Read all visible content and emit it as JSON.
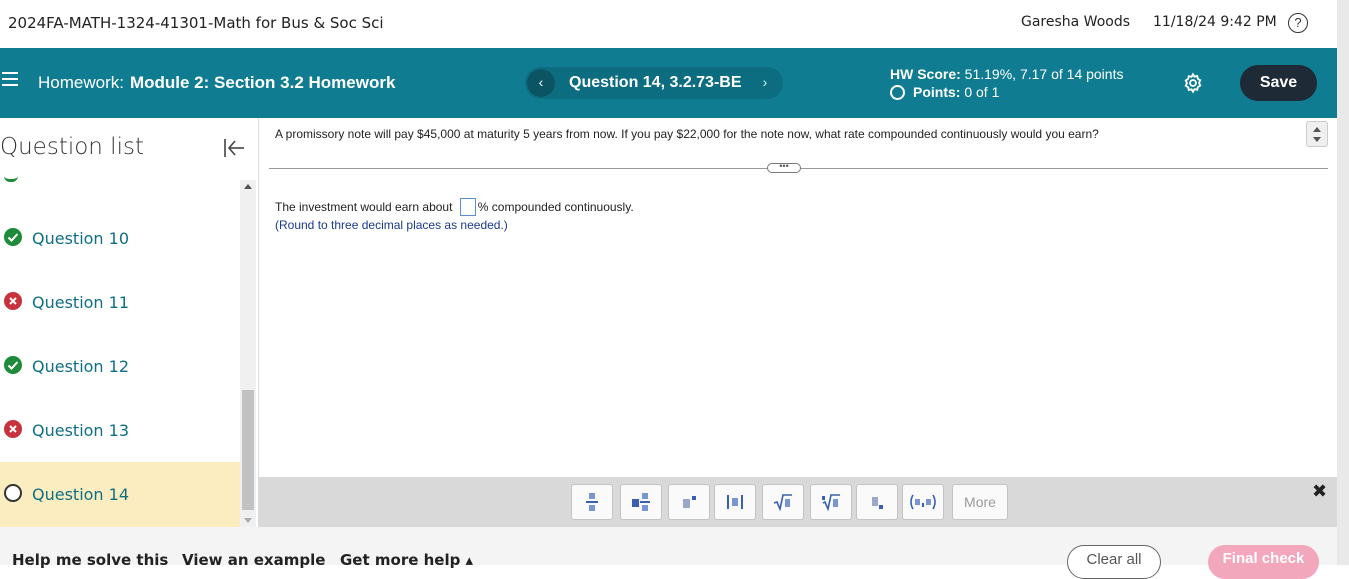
{
  "topbar": {
    "course_title": "2024FA-MATH-1324-41301-Math for Bus & Soc Sci",
    "user_name": "Garesha Woods",
    "datetime": "11/18/24 9:42 PM",
    "help_icon": "?"
  },
  "header": {
    "hw_prefix": "Homework:",
    "hw_name": "Module 2: Section 3.2 Homework",
    "prev_icon": "‹",
    "question_title": "Question 14, 3.2.73-BE",
    "next_icon": "›",
    "hw_score_label": "HW Score:",
    "hw_score_value": " 51.19%, 7.17 of 14 points",
    "points_label": "Points:",
    "points_value": " 0 of 1",
    "save_label": "Save",
    "accent_color": "#0f7c92"
  },
  "sidebar": {
    "title": "Question list",
    "items": [
      {
        "label": "Question 10",
        "status": "correct"
      },
      {
        "label": "Question 11",
        "status": "incorrect"
      },
      {
        "label": "Question 12",
        "status": "correct"
      },
      {
        "label": "Question 13",
        "status": "incorrect"
      },
      {
        "label": "Question 14",
        "status": "current"
      }
    ]
  },
  "question": {
    "text": "A promissory note will pay $45,000 at maturity 5 years from now. If you pay $22,000 for the note now, what rate compounded continuously would you earn?",
    "dots": "•••",
    "answer_before": "The investment would earn about ",
    "answer_after": "% compounded continuously.",
    "hint": "(Round to three decimal places as needed.)"
  },
  "toolbar": {
    "buttons": [
      "fraction-icon",
      "mixed-number-icon",
      "exponent-icon",
      "absolute-value-icon",
      "sqrt-icon",
      "nth-root-icon",
      "subscript-icon",
      "ordered-pair-icon"
    ],
    "more_label": "More",
    "close_icon": "✖"
  },
  "bottom": {
    "help_label": "Help me solve this",
    "example_label": "View an example",
    "more_help_label": "Get more help ▴",
    "clear_label": "Clear all",
    "final_label": "Final check"
  }
}
